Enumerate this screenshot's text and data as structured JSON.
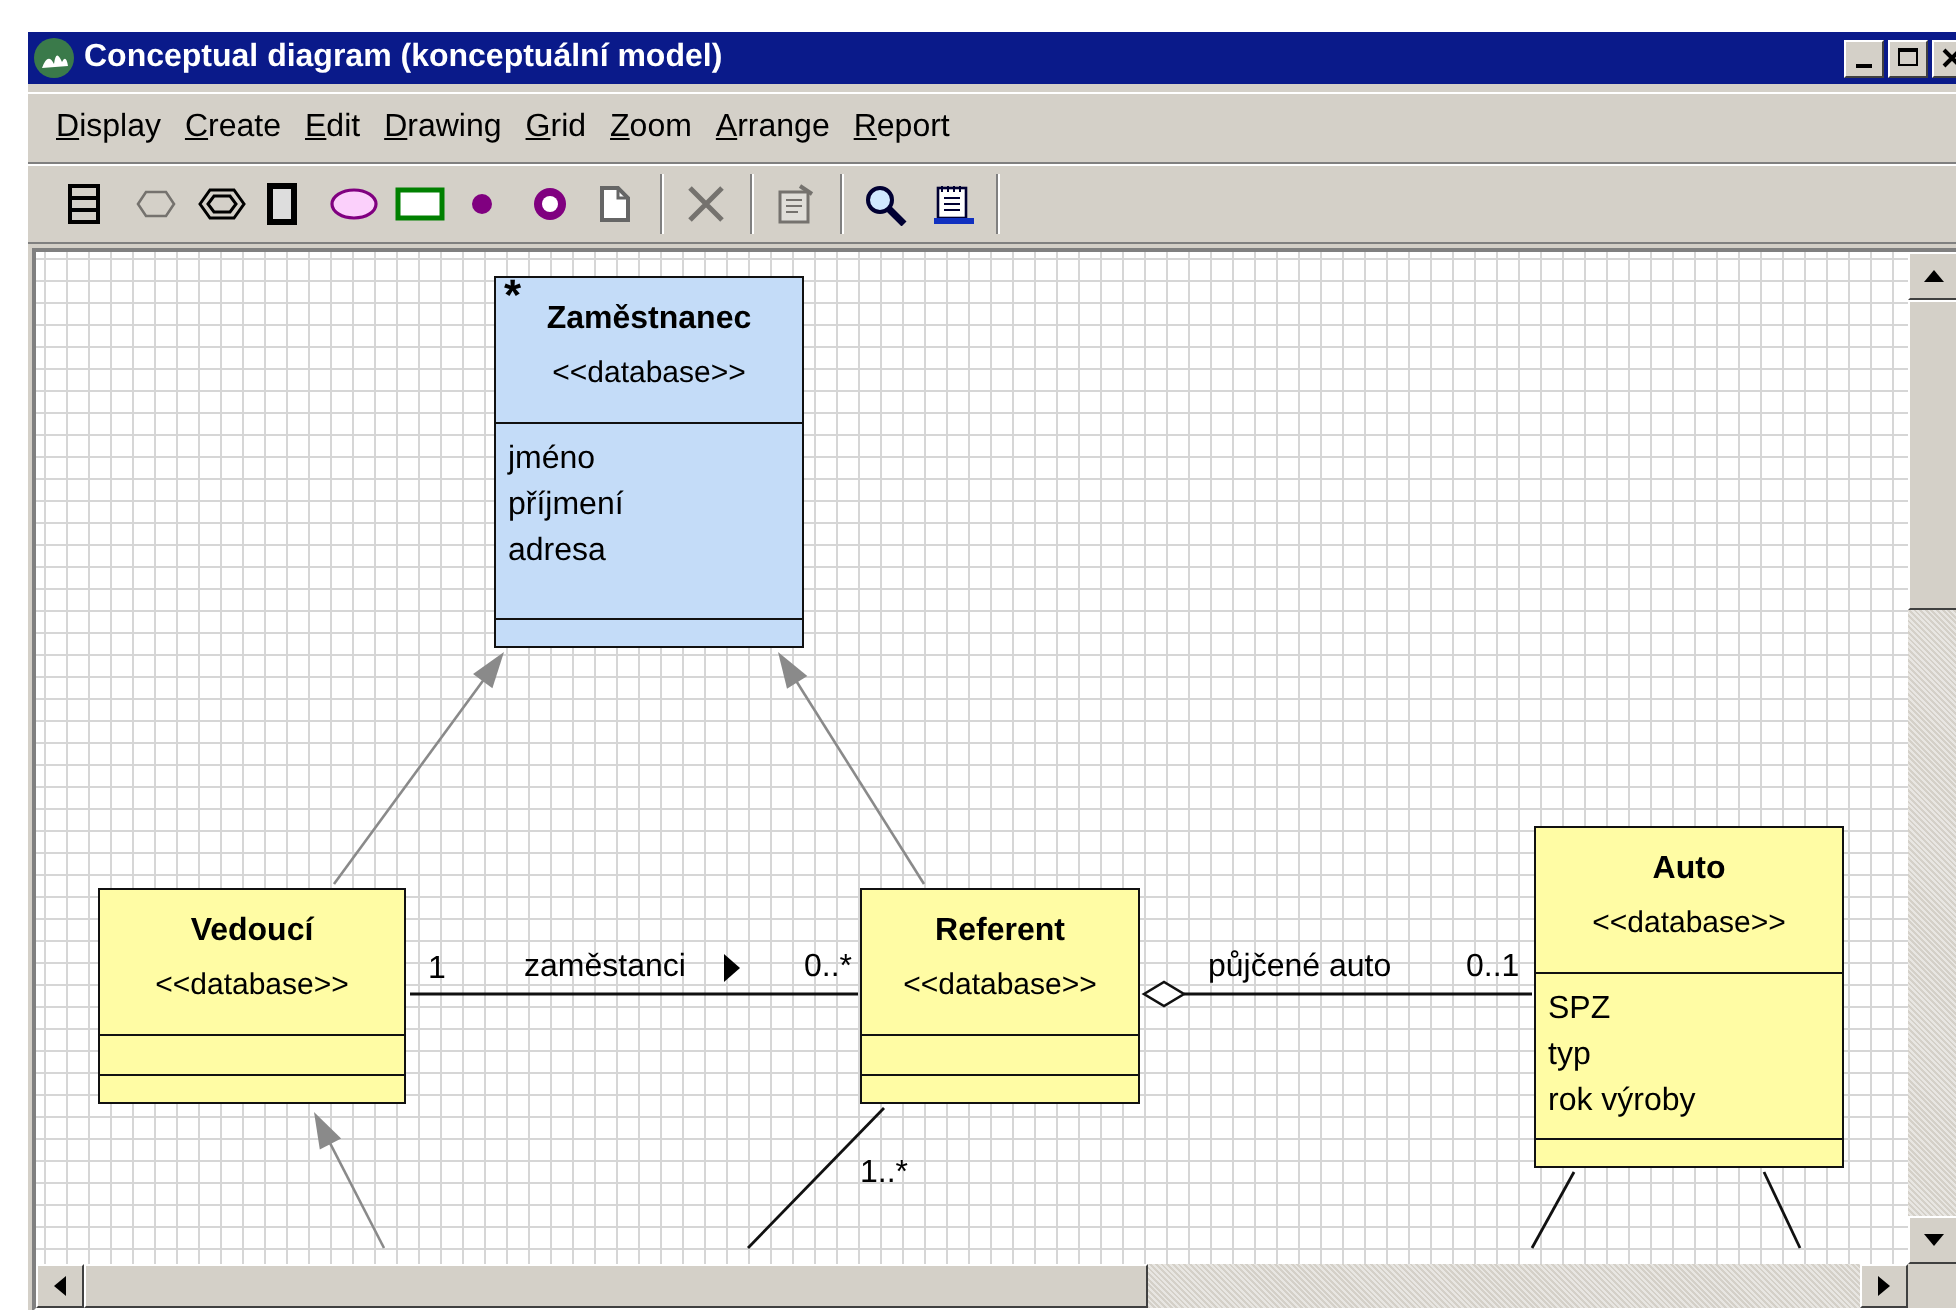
{
  "window": {
    "title": "Conceptual diagram (konceptuální model)"
  },
  "menu": [
    "Display",
    "Create",
    "Edit",
    "Drawing",
    "Grid",
    "Zoom",
    "Arrange",
    "Report"
  ],
  "toolbar": [
    {
      "tools": [
        {
          "kind": "class",
          "disabled": false
        },
        {
          "kind": "hexagon",
          "disabled": true
        },
        {
          "kind": "double-hexagon",
          "disabled": false
        },
        {
          "kind": "frame",
          "disabled": false
        },
        {
          "kind": "ellipse",
          "disabled": false
        },
        {
          "kind": "rectangle",
          "disabled": false
        },
        {
          "kind": "dot",
          "disabled": false
        },
        {
          "kind": "ring",
          "disabled": false
        },
        {
          "kind": "page",
          "disabled": false
        }
      ]
    },
    {
      "tools": [
        {
          "kind": "delete",
          "disabled": true
        }
      ]
    },
    {
      "tools": [
        {
          "kind": "properties",
          "disabled": true
        }
      ]
    },
    {
      "tools": [
        {
          "kind": "zoom",
          "disabled": false
        },
        {
          "kind": "html",
          "disabled": false
        }
      ]
    }
  ],
  "diagram": {
    "classes": [
      {
        "name": "Zaměstnanec",
        "stereotype": "<<database>>",
        "marker": "*",
        "color": "#c4dcf8",
        "attributes": [
          "jméno",
          "příjmení",
          "adresa"
        ]
      },
      {
        "name": "Vedoucí",
        "stereotype": "<<database>>",
        "color": "#fffca4"
      },
      {
        "name": "Referent",
        "stereotype": "<<database>>",
        "color": "#fffca4"
      },
      {
        "name": "Auto",
        "stereotype": "<<database>>",
        "color": "#fffca4",
        "attributes": [
          "SPZ",
          "typ",
          "rok výroby"
        ]
      }
    ],
    "links": [
      {
        "kind": "generalization"
      },
      {
        "kind": "generalization"
      },
      {
        "kind": "generalization"
      },
      {
        "kind": "association",
        "source_multiplicity": "1",
        "name": "zaměstanci",
        "reading_arrow": true,
        "target_multiplicity": "0..*"
      },
      {
        "kind": "aggregation",
        "name": "půjčené auto",
        "target_multiplicity": "0..1"
      },
      {
        "kind": "association",
        "source_multiplicity": "1..*"
      },
      {
        "kind": "association"
      },
      {
        "kind": "association"
      }
    ]
  }
}
